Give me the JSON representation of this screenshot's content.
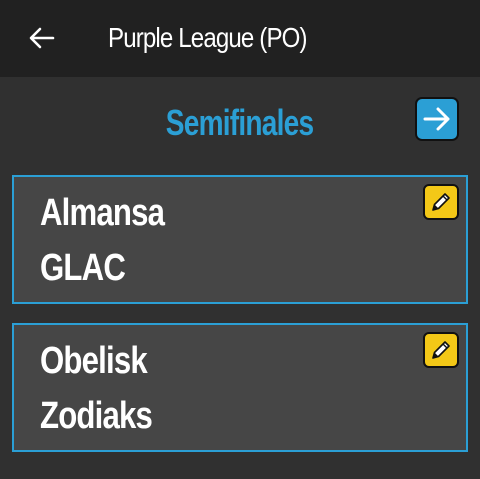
{
  "appbar": {
    "back_icon": "arrow-left-icon",
    "title": "Purple League (PO)"
  },
  "round": {
    "title": "Semifinales",
    "next_icon": "arrow-right-icon"
  },
  "matches": [
    {
      "home": "Almansa",
      "away": "GLAC",
      "edit_icon": "pencil-icon"
    },
    {
      "home": "Obelisk",
      "away": "Zodiaks",
      "edit_icon": "pencil-icon"
    }
  ],
  "colors": {
    "background": "#303030",
    "appbar": "#212121",
    "card": "#464646",
    "accent_blue": "#2b9fd5",
    "edit_yellow": "#f3c817",
    "text": "#ffffff"
  }
}
